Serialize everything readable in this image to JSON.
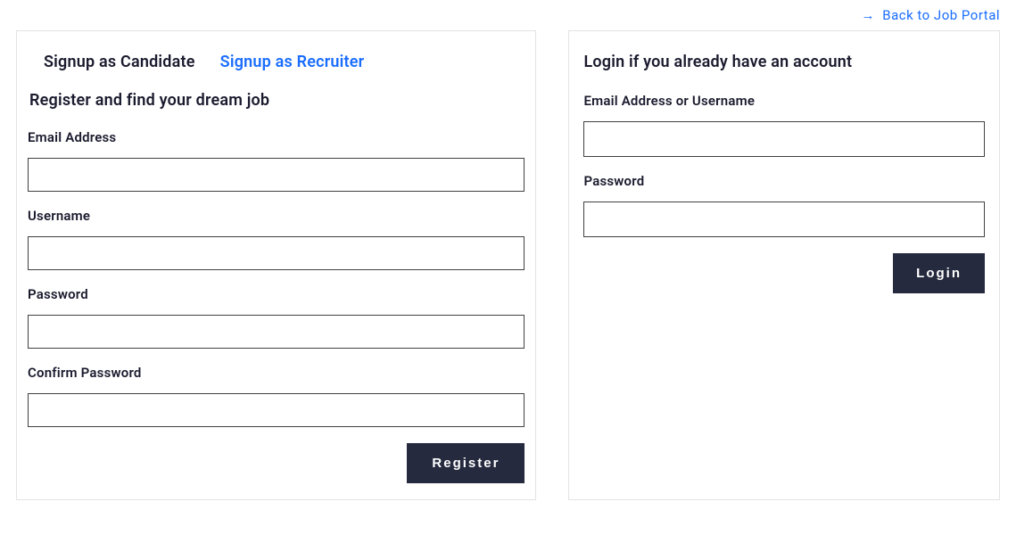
{
  "back_link": {
    "arrow": "→",
    "text": "Back to Job Portal"
  },
  "signup": {
    "tabs": {
      "candidate": "Signup as Candidate",
      "recruiter": "Signup as Recruiter"
    },
    "subheading": "Register and find your dream job",
    "fields": {
      "email_label": "Email Address",
      "username_label": "Username",
      "password_label": "Password",
      "confirm_password_label": "Confirm Password"
    },
    "register_button": "Register"
  },
  "login": {
    "heading": "Login if you already have an account",
    "fields": {
      "email_username_label": "Email Address or Username",
      "password_label": "Password"
    },
    "login_button": "Login"
  }
}
